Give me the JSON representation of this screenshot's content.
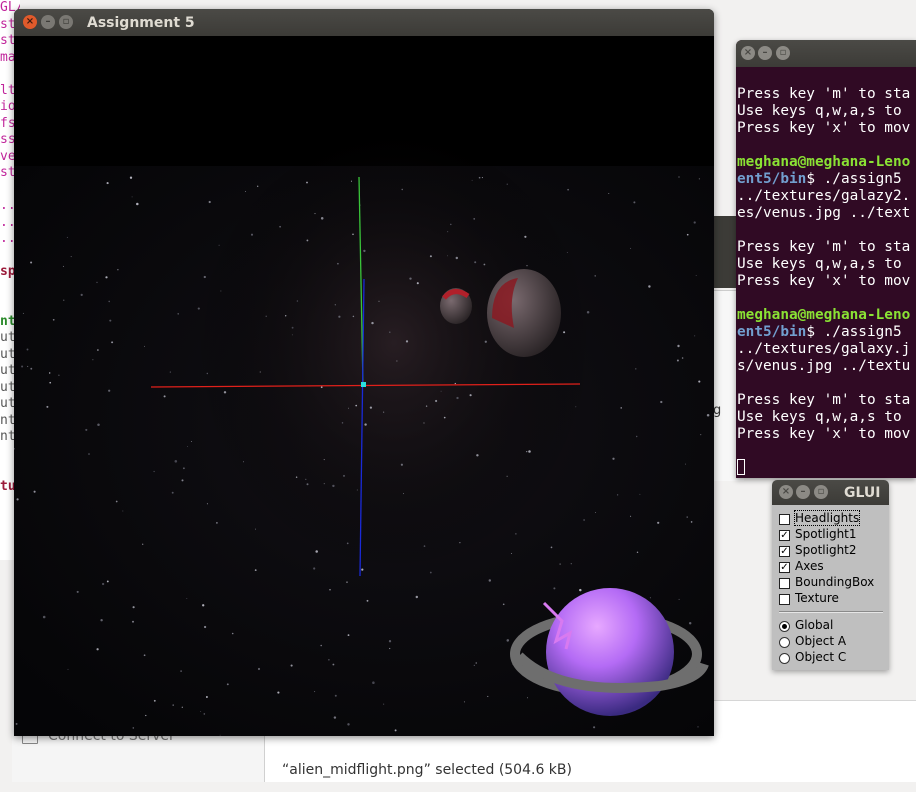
{
  "background_editor": {
    "lines": [
      {
        "text": "GL/glut.h",
        "cls": "c-mag"
      },
      {
        "text": "st",
        "cls": "c-mag"
      },
      {
        "text": "st",
        "cls": "c-mag"
      },
      {
        "text": "ma",
        "cls": "c-mag"
      },
      {
        "text": "",
        "cls": ""
      },
      {
        "text": "lt",
        "cls": "c-mag"
      },
      {
        "text": "io",
        "cls": "c-mag"
      },
      {
        "text": "fs",
        "cls": "c-mag"
      },
      {
        "text": "ss",
        "cls": "c-mag"
      },
      {
        "text": "ve",
        "cls": "c-mag"
      },
      {
        "text": "st",
        "cls": "c-mag"
      },
      {
        "text": "",
        "cls": ""
      },
      {
        "text": "..",
        "cls": "c-mag"
      },
      {
        "text": "..",
        "cls": "c-mag"
      },
      {
        "text": "..",
        "cls": "c-mag"
      },
      {
        "text": "",
        "cls": ""
      },
      {
        "text": "sp",
        "cls": "c-red"
      },
      {
        "text": "",
        "cls": ""
      },
      {
        "text": "",
        "cls": ""
      },
      {
        "text": "nt",
        "cls": "c-grn"
      },
      {
        "text": "ut",
        "cls": "c-gry"
      },
      {
        "text": "ut",
        "cls": "c-gry"
      },
      {
        "text": "ut",
        "cls": "c-gry"
      },
      {
        "text": "ut",
        "cls": "c-gry"
      },
      {
        "text": "ut",
        "cls": "c-gry"
      },
      {
        "text": "nt",
        "cls": "c-gry"
      },
      {
        "text": "nt",
        "cls": "c-gry"
      },
      {
        "text": "",
        "cls": ""
      },
      {
        "text": "",
        "cls": ""
      },
      {
        "text": "tu",
        "cls": "c-red"
      }
    ]
  },
  "file_manager": {
    "connect_label": "Connect to Server",
    "status": "“alien_midflight.png” selected  (504.6 kB)"
  },
  "background_window": {
    "partial_label": "g"
  },
  "gl_window": {
    "title": "Assignment 5",
    "scene": {
      "background": "#000000",
      "axis_colors": {
        "x": "#e0201a",
        "y": "#3ac43a",
        "z": "#1a2ad8"
      },
      "planet_color": "#b46bf5",
      "ring_color": "#7a7a7a"
    }
  },
  "terminal": {
    "lines": [
      [
        {
          "t": "Press key 'm' to sta",
          "c": ""
        }
      ],
      [
        {
          "t": "Use keys q,w,a,s to ",
          "c": ""
        }
      ],
      [
        {
          "t": "Press key 'x' to mov",
          "c": ""
        }
      ],
      [
        {
          "t": "",
          "c": ""
        }
      ],
      [
        {
          "t": "meghana@meghana-Leno",
          "c": "t-user"
        }
      ],
      [
        {
          "t": "ent5/bin",
          "c": "t-path"
        },
        {
          "t": "$ ./assign5",
          "c": ""
        }
      ],
      [
        {
          "t": "../textures/galazy2.",
          "c": ""
        }
      ],
      [
        {
          "t": "es/venus.jpg ../text",
          "c": ""
        }
      ],
      [
        {
          "t": "",
          "c": ""
        }
      ],
      [
        {
          "t": "Press key 'm' to sta",
          "c": ""
        }
      ],
      [
        {
          "t": "Use keys q,w,a,s to ",
          "c": ""
        }
      ],
      [
        {
          "t": "Press key 'x' to mov",
          "c": ""
        }
      ],
      [
        {
          "t": "",
          "c": ""
        }
      ],
      [
        {
          "t": "meghana@meghana-Leno",
          "c": "t-user"
        }
      ],
      [
        {
          "t": "ent5/bin",
          "c": "t-path"
        },
        {
          "t": "$ ./assign5",
          "c": ""
        }
      ],
      [
        {
          "t": "../textures/galaxy.j",
          "c": ""
        }
      ],
      [
        {
          "t": "s/venus.jpg ../textu",
          "c": ""
        }
      ],
      [
        {
          "t": "",
          "c": ""
        }
      ],
      [
        {
          "t": "Press key 'm' to sta",
          "c": ""
        }
      ],
      [
        {
          "t": "Use keys q,w,a,s to ",
          "c": ""
        }
      ],
      [
        {
          "t": "Press key 'x' to mov",
          "c": ""
        }
      ]
    ]
  },
  "glui": {
    "title": "GLUI",
    "checkboxes": [
      {
        "label": "Headlights",
        "checked": false,
        "focus": true
      },
      {
        "label": "Spotlight1",
        "checked": true,
        "focus": false
      },
      {
        "label": "Spotlight2",
        "checked": true,
        "focus": false
      },
      {
        "label": "Axes",
        "checked": true,
        "focus": false
      },
      {
        "label": "BoundingBox",
        "checked": false,
        "focus": false
      },
      {
        "label": "Texture",
        "checked": false,
        "focus": false
      }
    ],
    "radios": [
      {
        "label": "Global",
        "selected": true
      },
      {
        "label": "Object A",
        "selected": false
      },
      {
        "label": "Object C",
        "selected": false
      }
    ]
  }
}
